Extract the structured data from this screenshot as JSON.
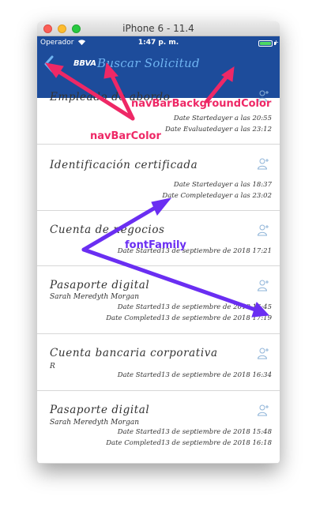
{
  "simulator": {
    "title": "iPhone 6 - 11.4"
  },
  "statusbar": {
    "carrier": "Operador",
    "time": "1:47 p. m."
  },
  "navbar": {
    "brand": "BBVA",
    "title": "Buscar Solicitud",
    "back_icon": "chevron-left-icon"
  },
  "colors": {
    "nav_background": "#1d4c9b",
    "nav_title": "#6fb4f2",
    "annotation_pink": "#ee2866",
    "annotation_purple": "#6a2ef2"
  },
  "cells": [
    {
      "title": "Empleado de abordo",
      "dates": [
        "Date Startedayer a las 20:55",
        "Date Evaluatedayer a las 23:12"
      ]
    },
    {
      "title": "Identificación certificada",
      "dates": [
        "Date Startedayer a las 18:37",
        "Date Completedayer a las 23:02"
      ]
    },
    {
      "title": "Cuenta de negocios",
      "dates": [
        "Date Started13 de septiembre de 2018 17:21"
      ]
    },
    {
      "title": "Pasaporte digital",
      "subtitle": "Sarah Meredyth Morgan",
      "dates": [
        "Date Started13 de septiembre de 2018 16:45",
        "Date Completed13 de septiembre de 2018 17:19"
      ]
    },
    {
      "title": "Cuenta bancaria corporativa",
      "subtitle": "R",
      "dates": [
        "Date Started13 de septiembre de 2018 16:34"
      ]
    },
    {
      "title": "Pasaporte digital",
      "subtitle": "Sarah Meredyth Morgan",
      "dates": [
        "Date Started13 de septiembre de 2018 15:48",
        "Date Completed13 de septiembre de 2018 16:18"
      ]
    }
  ],
  "annotations": {
    "nav_bar_background_color": "navBarBackgroundColor",
    "nav_bar_color": "navBarColor",
    "font_family": "fontFamily"
  }
}
